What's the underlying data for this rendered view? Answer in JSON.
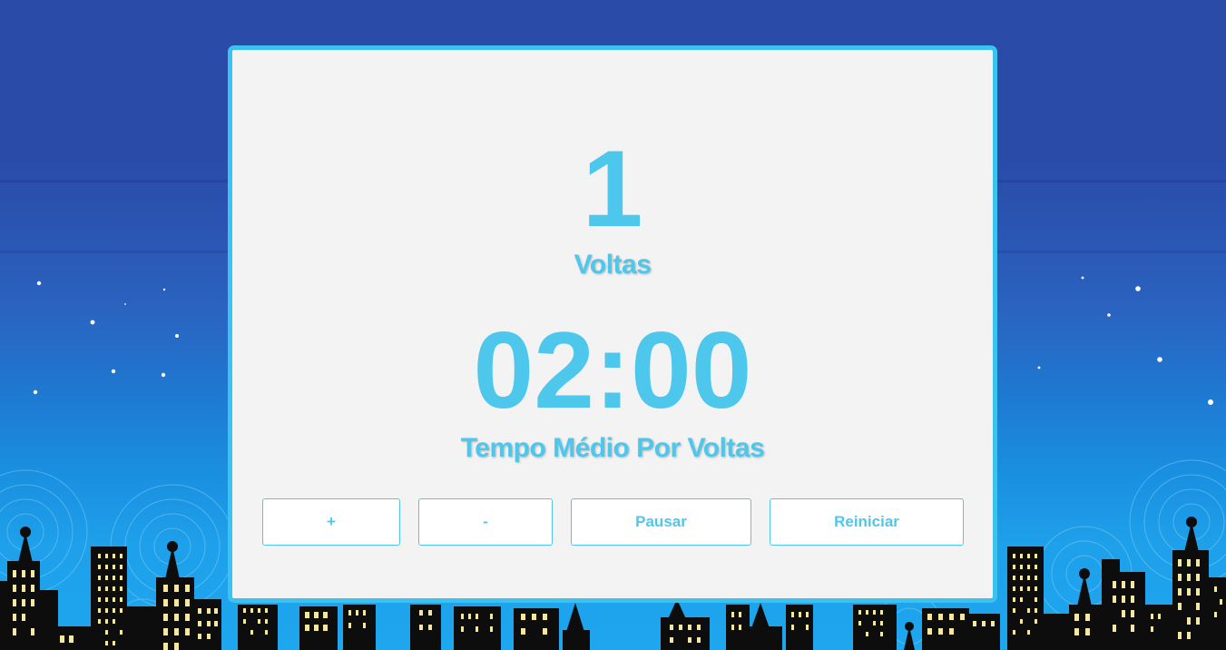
{
  "counter": {
    "laps_value": "1",
    "laps_label": "Voltas"
  },
  "timer": {
    "value": "02:00",
    "label": "Tempo Médio Por Voltas"
  },
  "buttons": {
    "increment": "+",
    "decrement": "-",
    "pause": "Pausar",
    "reset": "Reiniciar"
  },
  "colors": {
    "accent": "#4ec7ec",
    "panel_border": "#3cc2ee",
    "panel_background": "#f3f3f3",
    "sky_top": "#2a4ba8",
    "sky_bottom": "#1ea6ee",
    "building": "#0d0d0d",
    "window_light": "#f3e7a2"
  },
  "background": {
    "scene": "night-city-skyline"
  }
}
